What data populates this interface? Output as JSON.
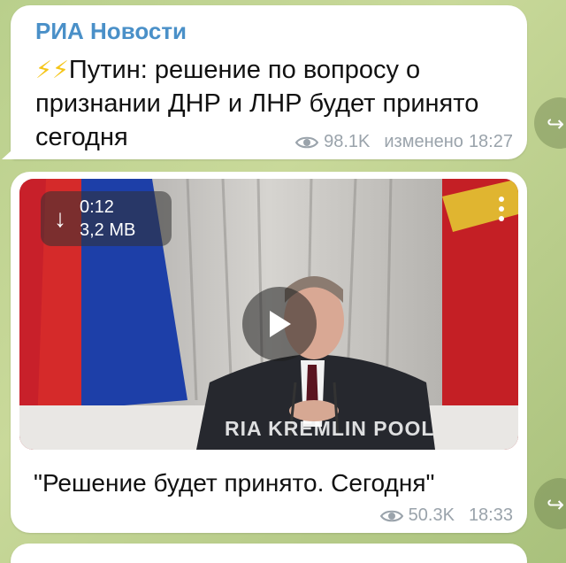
{
  "messages": [
    {
      "channel": "РИА Новости",
      "emoji": "⚡⚡",
      "text": "Путин: решение по вопросу о признании ДНР и ЛНР будет принято сегодня",
      "views": "98.1K",
      "edited": "изменено",
      "time": "18:27"
    },
    {
      "video": {
        "duration": "0:12",
        "size": "3,2 MB",
        "watermark": "RIA KREMLIN POOL"
      },
      "caption": "\"Решение будет принято. Сегодня\"",
      "views": "50.3K",
      "time": "18:33"
    }
  ],
  "colors": {
    "channel_name": "#4a90c8",
    "meta_text": "#9aa3ab",
    "chat_background": "#b9cf8c"
  }
}
